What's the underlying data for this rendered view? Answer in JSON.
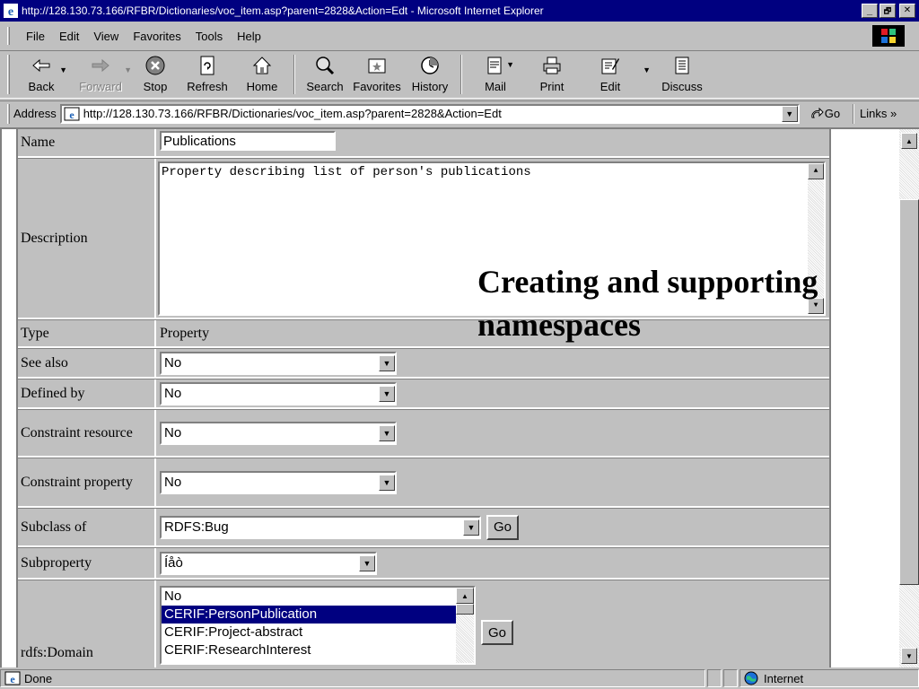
{
  "window": {
    "title": "http://128.130.73.166/RFBR/Dictionaries/voc_item.asp?parent=2828&Action=Edt - Microsoft Internet Explorer",
    "minimize": "_",
    "maximize": "🗗",
    "close": "✕"
  },
  "menu": {
    "file": "File",
    "edit": "Edit",
    "view": "View",
    "favorites": "Favorites",
    "tools": "Tools",
    "help": "Help"
  },
  "toolbar": {
    "back": "Back",
    "forward": "Forward",
    "stop": "Stop",
    "refresh": "Refresh",
    "home": "Home",
    "search": "Search",
    "favorites": "Favorites",
    "history": "History",
    "mail": "Mail",
    "print": "Print",
    "edit": "Edit",
    "discuss": "Discuss"
  },
  "address": {
    "label": "Address",
    "url": "http://128.130.73.166/RFBR/Dictionaries/voc_item.asp?parent=2828&Action=Edt",
    "go": "Go",
    "links": "Links »"
  },
  "form": {
    "name": {
      "label": "Name",
      "value": "Publications"
    },
    "description": {
      "label": "Description",
      "value": "Property describing list of person's publications"
    },
    "type": {
      "label": "Type",
      "value": "Property"
    },
    "see_also": {
      "label": "See also",
      "value": "No"
    },
    "defined_by": {
      "label": "Defined by",
      "value": "No"
    },
    "constraint_resource": {
      "label": "Constraint resource",
      "value": "No"
    },
    "constraint_property": {
      "label": "Constraint property",
      "value": "No"
    },
    "subclass_of": {
      "label": "Subclass of",
      "value": "RDFS:Bug",
      "go": "Go"
    },
    "subproperty": {
      "label": "Subproperty",
      "value": "Íåò"
    },
    "rdfs_domain": {
      "label": "rdfs:Domain",
      "options": [
        "No",
        "CERIF:PersonPublication",
        "CERIF:Project-abstract",
        "CERIF:ResearchInterest"
      ],
      "selected_index": 1,
      "go": "Go"
    }
  },
  "slide": {
    "title": "Creating and supporting namespaces"
  },
  "status": {
    "text": "Done",
    "zone": "Internet"
  }
}
